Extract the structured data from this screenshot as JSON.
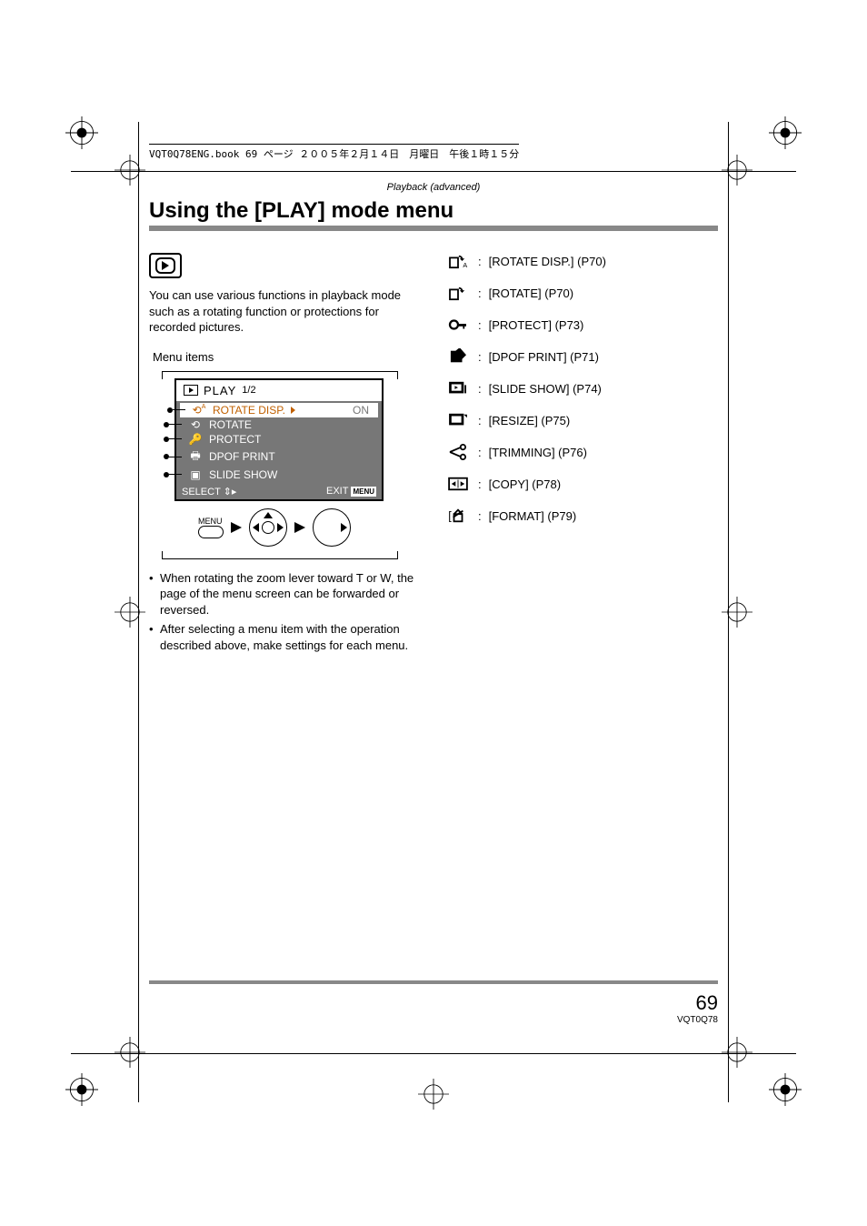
{
  "header_text": "VQT0Q78ENG.book  69 ページ  ２００５年２月１４日　月曜日　午後１時１５分",
  "section_header": "Playback (advanced)",
  "page_title": "Using the [PLAY] mode menu",
  "intro": "You can use various functions in playback mode such as a rotating function or protections for recorded pictures.",
  "menu_items_label": "Menu items",
  "menu_sim": {
    "title": "PLAY",
    "page_frac": "1/2",
    "rows": [
      {
        "label": "ROTATE DISP.",
        "value": "ON",
        "selected": true
      },
      {
        "label": "ROTATE"
      },
      {
        "label": "PROTECT"
      },
      {
        "label": "DPOF PRINT"
      },
      {
        "label": "SLIDE SHOW"
      }
    ],
    "select_label": "SELECT",
    "exit_label": "EXIT",
    "exit_box": "MENU",
    "nav_label": "MENU"
  },
  "bullets": [
    "When rotating the zoom lever toward T or W, the page of the menu screen can be forwarded or reversed.",
    "After selecting a menu item with the operation described above, make settings for each menu."
  ],
  "references": [
    {
      "label": "[ROTATE DISP.] (P70)"
    },
    {
      "label": "[ROTATE] (P70)"
    },
    {
      "label": "[PROTECT] (P73)"
    },
    {
      "label": "[DPOF PRINT] (P71)"
    },
    {
      "label": "[SLIDE SHOW] (P74)"
    },
    {
      "label": "[RESIZE] (P75)"
    },
    {
      "label": "[TRIMMING] (P76)"
    },
    {
      "label": "[COPY] (P78)"
    },
    {
      "label": "[FORMAT] (P79)"
    }
  ],
  "page_number": "69",
  "doc_code": "VQT0Q78"
}
